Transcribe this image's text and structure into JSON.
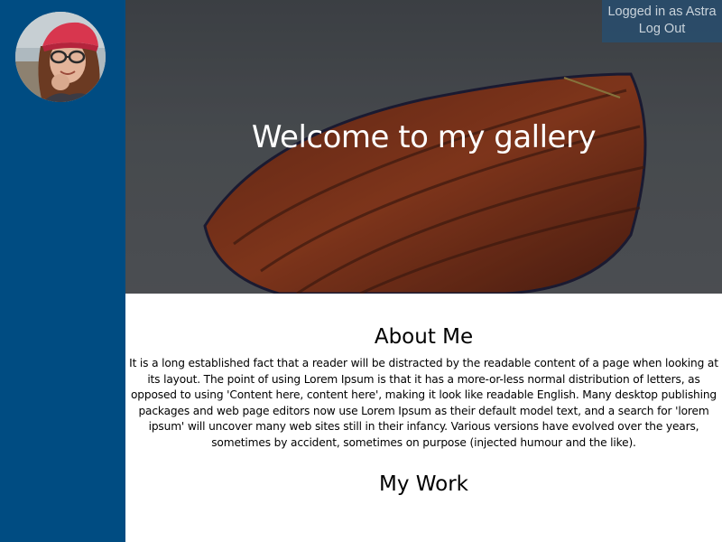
{
  "header": {
    "title": "Welcome to my gallery"
  },
  "user": {
    "status_text": "Logged in as Astra",
    "logout_label": "Log Out"
  },
  "about": {
    "heading": "About Me",
    "text": "It is a long established fact that a reader will be distracted by the readable content of a page when looking at its layout. The point of using Lorem Ipsum is that it has a more-or-less normal distribution of letters, as opposed to using 'Content here, content here', making it look like readable English. Many desktop publishing packages and web page editors now use Lorem Ipsum as their default model text, and a search for 'lorem ipsum' will uncover many web sites still in their infancy. Various versions have evolved over the years, sometimes by accident, sometimes on purpose (injected humour and the like)."
  },
  "work": {
    "heading": "My Work"
  },
  "colors": {
    "sidebar": "#004c82",
    "login_box": "#284e6e",
    "hero_overlay": "#555b60",
    "boat_hull": "#c2461a",
    "text": "#000000",
    "hero_text": "#ffffff"
  },
  "images": {
    "avatar": "profile-photo",
    "hero": "boat-photo"
  }
}
